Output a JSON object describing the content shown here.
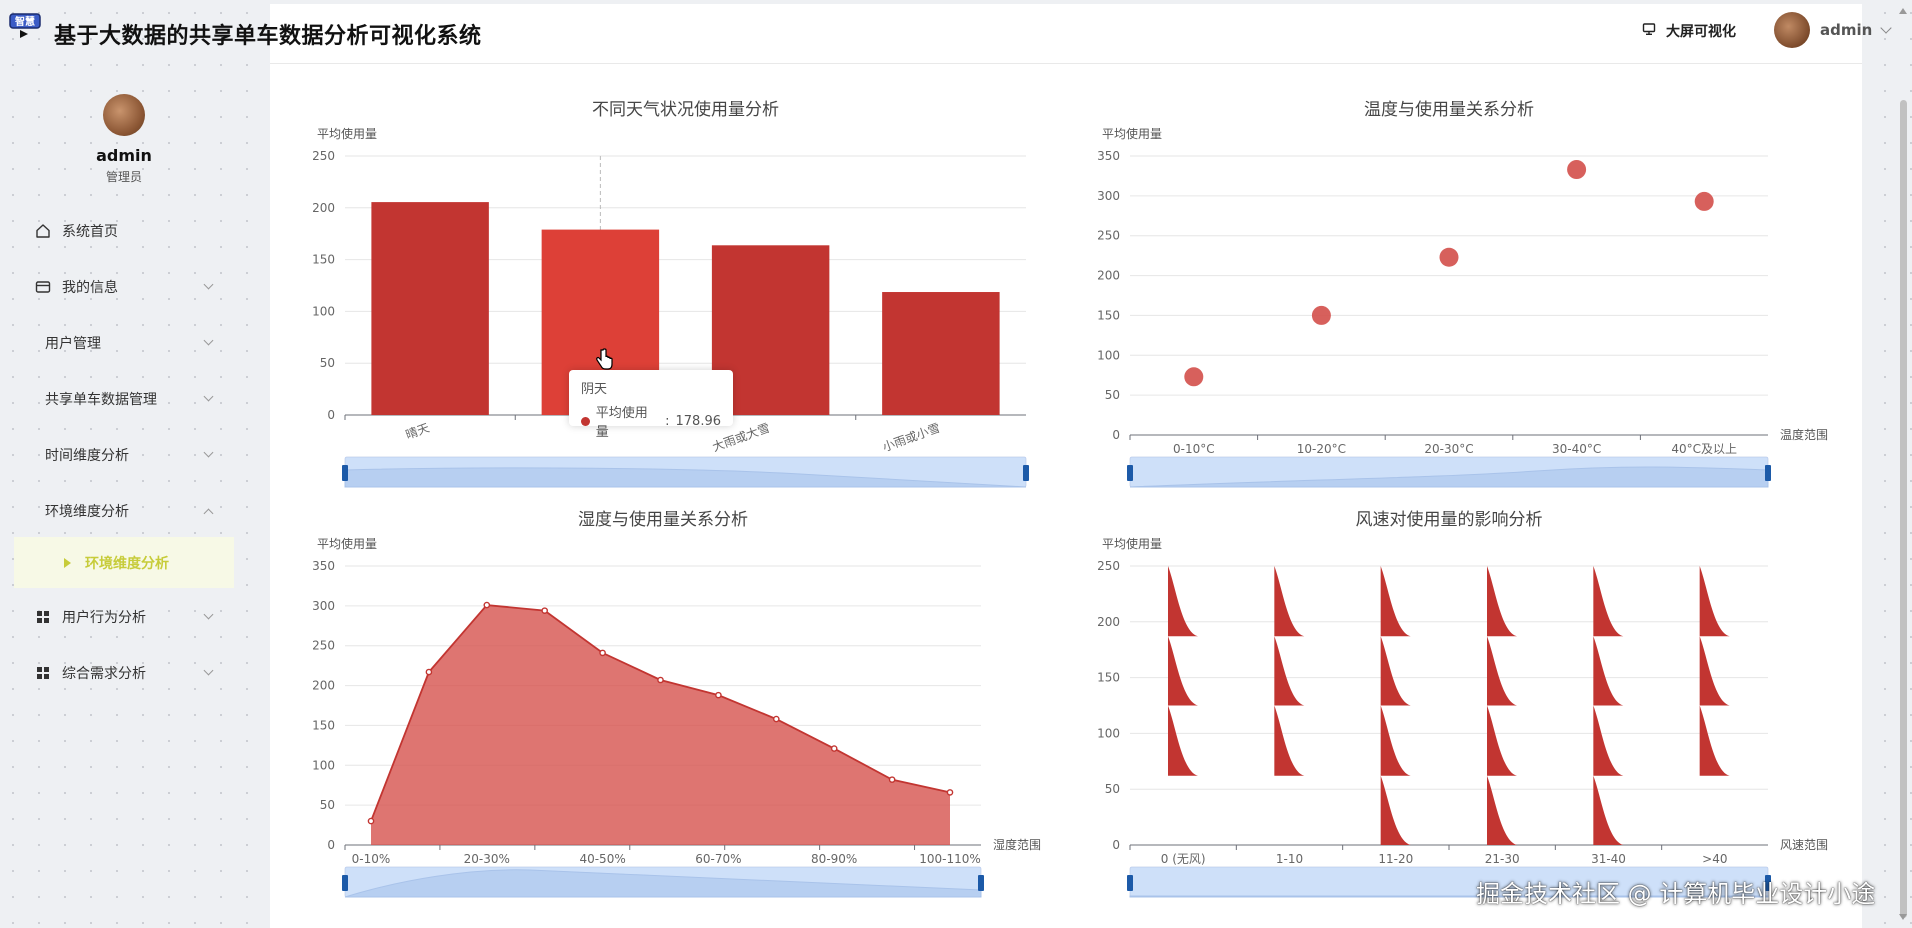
{
  "app": {
    "title": "基于大数据的共享单车数据分析可视化系统",
    "logo_text": "智慧",
    "bigscreen_label": "大屏可视化",
    "user": "admin"
  },
  "sidebar": {
    "name": "admin",
    "role": "管理员",
    "items": [
      {
        "label": "系统首页",
        "icon": "home-icon"
      },
      {
        "label": "我的信息",
        "icon": "card-icon"
      },
      {
        "label": "用户管理",
        "icon": ""
      },
      {
        "label": "共享单车数据管理",
        "icon": ""
      },
      {
        "label": "时间维度分析",
        "icon": ""
      },
      {
        "label": "环境维度分析",
        "icon": ""
      },
      {
        "label": "用户行为分析",
        "icon": "grid-icon"
      },
      {
        "label": "综合需求分析",
        "icon": "grid-icon"
      }
    ],
    "active_sub": "环境维度分析"
  },
  "tooltip": {
    "title": "阴天",
    "series": "平均使用量",
    "value": "178.96"
  },
  "watermark": "掘金技术社区 @ 计算机毕业设计小途",
  "colors": {
    "series": "#c23531",
    "accent": "#c7cc3a"
  },
  "chart_data": [
    {
      "type": "bar",
      "title": "不同天气状况使用量分析",
      "ylabel": "平均使用量",
      "xlabel": "",
      "categories": [
        "晴天",
        "阴天",
        "大雨或大雪",
        "小雨或小雪"
      ],
      "category_labels_shown": [
        "晴天",
        "",
        "大雨或大雪",
        "小雨或小雪"
      ],
      "values": [
        205.5,
        178.96,
        163.8,
        118.7
      ],
      "ylim": [
        0,
        250
      ],
      "yticks": [
        0,
        50,
        100,
        150,
        200,
        250
      ],
      "highlight_index": 1,
      "grid": true
    },
    {
      "type": "scatter",
      "title": "温度与使用量关系分析",
      "ylabel": "平均使用量",
      "xlabel": "温度范围",
      "categories": [
        "0-10°C",
        "10-20°C",
        "20-30°C",
        "30-40°C",
        "40°C及以上"
      ],
      "values": [
        73,
        150,
        223,
        333,
        293
      ],
      "ylim": [
        0,
        350
      ],
      "yticks": [
        0,
        50,
        100,
        150,
        200,
        250,
        300,
        350
      ],
      "grid": true
    },
    {
      "type": "area",
      "title": "湿度与使用量关系分析",
      "ylabel": "平均使用量",
      "xlabel": "湿度范围",
      "x_labels": [
        "0-10%",
        "20-30%",
        "40-50%",
        "60-70%",
        "80-90%",
        "100-110%"
      ],
      "values": [
        30,
        217,
        301,
        294,
        241,
        207,
        188,
        158,
        121,
        82,
        66
      ],
      "ylim": [
        0,
        350
      ],
      "yticks": [
        0,
        50,
        100,
        150,
        200,
        250,
        300,
        350
      ],
      "grid": true
    },
    {
      "type": "bar",
      "title": "风速对使用量的影响分析",
      "ylabel": "平均使用量",
      "xlabel": "风速范围",
      "categories": [
        "0 (无风)",
        "1-10",
        "11-20",
        "21-30",
        "31-40",
        ">40"
      ],
      "values": [
        250,
        250,
        250,
        250,
        250,
        250
      ],
      "segments": [
        [
          [
            187,
            250
          ],
          [
            125,
            187
          ],
          [
            62,
            125
          ]
        ],
        [
          [
            187,
            250
          ],
          [
            125,
            187
          ],
          [
            62,
            125
          ]
        ],
        [
          [
            187,
            250
          ],
          [
            125,
            187
          ],
          [
            62,
            125
          ],
          [
            0,
            62
          ]
        ],
        [
          [
            187,
            250
          ],
          [
            125,
            187
          ],
          [
            62,
            125
          ],
          [
            0,
            62
          ]
        ],
        [
          [
            187,
            250
          ],
          [
            125,
            187
          ],
          [
            62,
            125
          ],
          [
            0,
            62
          ]
        ],
        [
          [
            187,
            250
          ],
          [
            125,
            187
          ],
          [
            62,
            125
          ]
        ]
      ],
      "ylim": [
        0,
        250
      ],
      "yticks": [
        0,
        50,
        100,
        150,
        200,
        250
      ],
      "grid": true
    }
  ]
}
